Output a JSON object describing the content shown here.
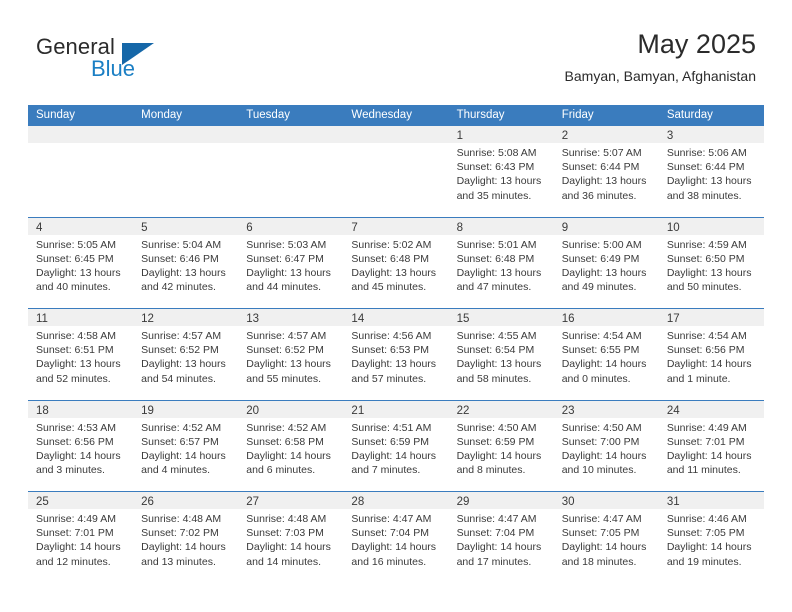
{
  "brand": {
    "name_part1": "General",
    "name_part2": "Blue",
    "accent_color": "#1b7fc4",
    "triangle_color": "#1567a8"
  },
  "header": {
    "title": "May 2025",
    "subtitle": "Bamyan, Bamyan, Afghanistan"
  },
  "calendar": {
    "header_bg": "#3a7cbe",
    "day_band_bg": "#f0f0f0",
    "weekdays": [
      "Sunday",
      "Monday",
      "Tuesday",
      "Wednesday",
      "Thursday",
      "Friday",
      "Saturday"
    ],
    "weeks": [
      [
        {
          "day": "",
          "empty": true
        },
        {
          "day": "",
          "empty": true
        },
        {
          "day": "",
          "empty": true
        },
        {
          "day": "",
          "empty": true
        },
        {
          "day": "1",
          "sunrise": "Sunrise: 5:08 AM",
          "sunset": "Sunset: 6:43 PM",
          "daylight": "Daylight: 13 hours and 35 minutes."
        },
        {
          "day": "2",
          "sunrise": "Sunrise: 5:07 AM",
          "sunset": "Sunset: 6:44 PM",
          "daylight": "Daylight: 13 hours and 36 minutes."
        },
        {
          "day": "3",
          "sunrise": "Sunrise: 5:06 AM",
          "sunset": "Sunset: 6:44 PM",
          "daylight": "Daylight: 13 hours and 38 minutes."
        }
      ],
      [
        {
          "day": "4",
          "sunrise": "Sunrise: 5:05 AM",
          "sunset": "Sunset: 6:45 PM",
          "daylight": "Daylight: 13 hours and 40 minutes."
        },
        {
          "day": "5",
          "sunrise": "Sunrise: 5:04 AM",
          "sunset": "Sunset: 6:46 PM",
          "daylight": "Daylight: 13 hours and 42 minutes."
        },
        {
          "day": "6",
          "sunrise": "Sunrise: 5:03 AM",
          "sunset": "Sunset: 6:47 PM",
          "daylight": "Daylight: 13 hours and 44 minutes."
        },
        {
          "day": "7",
          "sunrise": "Sunrise: 5:02 AM",
          "sunset": "Sunset: 6:48 PM",
          "daylight": "Daylight: 13 hours and 45 minutes."
        },
        {
          "day": "8",
          "sunrise": "Sunrise: 5:01 AM",
          "sunset": "Sunset: 6:48 PM",
          "daylight": "Daylight: 13 hours and 47 minutes."
        },
        {
          "day": "9",
          "sunrise": "Sunrise: 5:00 AM",
          "sunset": "Sunset: 6:49 PM",
          "daylight": "Daylight: 13 hours and 49 minutes."
        },
        {
          "day": "10",
          "sunrise": "Sunrise: 4:59 AM",
          "sunset": "Sunset: 6:50 PM",
          "daylight": "Daylight: 13 hours and 50 minutes."
        }
      ],
      [
        {
          "day": "11",
          "sunrise": "Sunrise: 4:58 AM",
          "sunset": "Sunset: 6:51 PM",
          "daylight": "Daylight: 13 hours and 52 minutes."
        },
        {
          "day": "12",
          "sunrise": "Sunrise: 4:57 AM",
          "sunset": "Sunset: 6:52 PM",
          "daylight": "Daylight: 13 hours and 54 minutes."
        },
        {
          "day": "13",
          "sunrise": "Sunrise: 4:57 AM",
          "sunset": "Sunset: 6:52 PM",
          "daylight": "Daylight: 13 hours and 55 minutes."
        },
        {
          "day": "14",
          "sunrise": "Sunrise: 4:56 AM",
          "sunset": "Sunset: 6:53 PM",
          "daylight": "Daylight: 13 hours and 57 minutes."
        },
        {
          "day": "15",
          "sunrise": "Sunrise: 4:55 AM",
          "sunset": "Sunset: 6:54 PM",
          "daylight": "Daylight: 13 hours and 58 minutes."
        },
        {
          "day": "16",
          "sunrise": "Sunrise: 4:54 AM",
          "sunset": "Sunset: 6:55 PM",
          "daylight": "Daylight: 14 hours and 0 minutes."
        },
        {
          "day": "17",
          "sunrise": "Sunrise: 4:54 AM",
          "sunset": "Sunset: 6:56 PM",
          "daylight": "Daylight: 14 hours and 1 minute."
        }
      ],
      [
        {
          "day": "18",
          "sunrise": "Sunrise: 4:53 AM",
          "sunset": "Sunset: 6:56 PM",
          "daylight": "Daylight: 14 hours and 3 minutes."
        },
        {
          "day": "19",
          "sunrise": "Sunrise: 4:52 AM",
          "sunset": "Sunset: 6:57 PM",
          "daylight": "Daylight: 14 hours and 4 minutes."
        },
        {
          "day": "20",
          "sunrise": "Sunrise: 4:52 AM",
          "sunset": "Sunset: 6:58 PM",
          "daylight": "Daylight: 14 hours and 6 minutes."
        },
        {
          "day": "21",
          "sunrise": "Sunrise: 4:51 AM",
          "sunset": "Sunset: 6:59 PM",
          "daylight": "Daylight: 14 hours and 7 minutes."
        },
        {
          "day": "22",
          "sunrise": "Sunrise: 4:50 AM",
          "sunset": "Sunset: 6:59 PM",
          "daylight": "Daylight: 14 hours and 8 minutes."
        },
        {
          "day": "23",
          "sunrise": "Sunrise: 4:50 AM",
          "sunset": "Sunset: 7:00 PM",
          "daylight": "Daylight: 14 hours and 10 minutes."
        },
        {
          "day": "24",
          "sunrise": "Sunrise: 4:49 AM",
          "sunset": "Sunset: 7:01 PM",
          "daylight": "Daylight: 14 hours and 11 minutes."
        }
      ],
      [
        {
          "day": "25",
          "sunrise": "Sunrise: 4:49 AM",
          "sunset": "Sunset: 7:01 PM",
          "daylight": "Daylight: 14 hours and 12 minutes."
        },
        {
          "day": "26",
          "sunrise": "Sunrise: 4:48 AM",
          "sunset": "Sunset: 7:02 PM",
          "daylight": "Daylight: 14 hours and 13 minutes."
        },
        {
          "day": "27",
          "sunrise": "Sunrise: 4:48 AM",
          "sunset": "Sunset: 7:03 PM",
          "daylight": "Daylight: 14 hours and 14 minutes."
        },
        {
          "day": "28",
          "sunrise": "Sunrise: 4:47 AM",
          "sunset": "Sunset: 7:04 PM",
          "daylight": "Daylight: 14 hours and 16 minutes."
        },
        {
          "day": "29",
          "sunrise": "Sunrise: 4:47 AM",
          "sunset": "Sunset: 7:04 PM",
          "daylight": "Daylight: 14 hours and 17 minutes."
        },
        {
          "day": "30",
          "sunrise": "Sunrise: 4:47 AM",
          "sunset": "Sunset: 7:05 PM",
          "daylight": "Daylight: 14 hours and 18 minutes."
        },
        {
          "day": "31",
          "sunrise": "Sunrise: 4:46 AM",
          "sunset": "Sunset: 7:05 PM",
          "daylight": "Daylight: 14 hours and 19 minutes."
        }
      ]
    ]
  }
}
